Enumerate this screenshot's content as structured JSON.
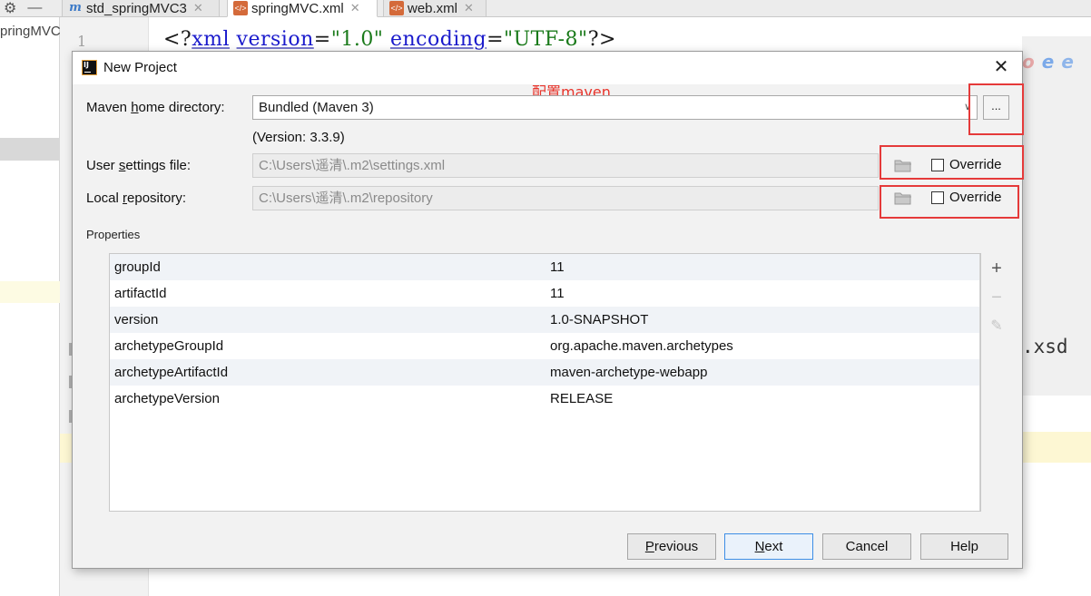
{
  "ide": {
    "project_label": "pringMVC",
    "line_number": "1",
    "tabs": [
      {
        "label": "std_springMVC3",
        "icon": "maven-icon"
      },
      {
        "label": "springMVC.xml",
        "icon": "xml-file-icon"
      },
      {
        "label": "web.xml",
        "icon": "xml-file-icon"
      }
    ],
    "code": {
      "open": "<?",
      "xml_kw": "xml",
      "version_attr": "version",
      "eq1": "=",
      "version_val": "\"1.0\"",
      "encoding_attr": "encoding",
      "eq2": "=",
      "encoding_val": "\"UTF-8\"",
      "close": "?>"
    },
    "code_right_fragment": ".xsd"
  },
  "dialog": {
    "title": "New Project",
    "annotation": "配置maven",
    "maven_home": {
      "label_pre": "Maven ",
      "label_mnemonic": "h",
      "label_post": "ome directory:",
      "value": "Bundled (Maven 3)",
      "browse_label": "..."
    },
    "version_text": "(Version: 3.3.9)",
    "user_settings": {
      "label_pre": "User ",
      "label_mnemonic": "s",
      "label_post": "ettings file:",
      "value": "C:\\Users\\遥清\\.m2\\settings.xml",
      "override_label": "Override"
    },
    "local_repo": {
      "label_pre": "Local ",
      "label_mnemonic": "r",
      "label_post": "epository:",
      "value": "C:\\Users\\遥清\\.m2\\repository",
      "override_label": "Override"
    },
    "properties_label": "Properties",
    "properties": [
      {
        "key": "groupId",
        "value": "11"
      },
      {
        "key": "artifactId",
        "value": "11"
      },
      {
        "key": "version",
        "value": "1.0-SNAPSHOT"
      },
      {
        "key": "archetypeGroupId",
        "value": "org.apache.maven.archetypes"
      },
      {
        "key": "archetypeArtifactId",
        "value": "maven-archetype-webapp"
      },
      {
        "key": "archetypeVersion",
        "value": "RELEASE"
      }
    ],
    "buttons": {
      "previous": {
        "mnemonic": "P",
        "rest": "revious"
      },
      "next": {
        "mnemonic": "N",
        "rest": "ext"
      },
      "cancel": "Cancel",
      "help": "Help"
    }
  },
  "colors": {
    "annotation_red": "#e53a3a",
    "default_button_border": "#3d8ee6"
  }
}
